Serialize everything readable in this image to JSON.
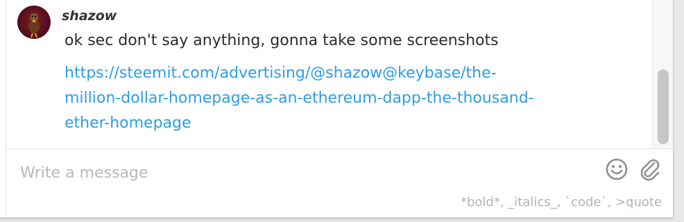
{
  "conversation": {
    "message": {
      "author": "shazow",
      "text": "ok sec don't say anything, gonna take some screenshots",
      "link_lines": [
        "https://steemit.com/advertising/@shazow@keybase/the-",
        "million-dollar-homepage-as-an-ethereum-dapp-the-thousand-",
        "ether-homepage"
      ]
    }
  },
  "composer": {
    "placeholder": "Write a message",
    "format_hint": "*bold*, _italics_, `code`, >quote",
    "emoji_icon": "smiley-icon",
    "attach_icon": "paperclip-icon"
  },
  "colors": {
    "link": "#2a9ee8",
    "text": "#2b2b2b",
    "placeholder": "#b8b8b8",
    "hint": "#b3b3b3",
    "scroll_thumb": "#c6c6c6"
  }
}
